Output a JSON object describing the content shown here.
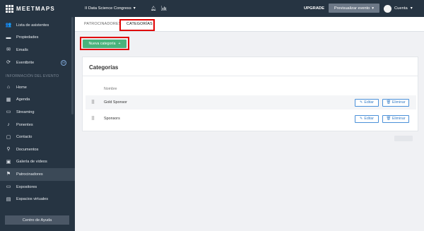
{
  "brand": {
    "name": "MEETMAPS"
  },
  "sidebar": {
    "top_items": [
      {
        "label": "Lista de asistentes",
        "icon": "users-icon",
        "glyph": "👥"
      },
      {
        "label": "Propiedades",
        "icon": "folder-icon",
        "glyph": "▬"
      },
      {
        "label": "Emails",
        "icon": "mail-icon",
        "glyph": "✉"
      },
      {
        "label": "Eventbrite",
        "icon": "sync-icon",
        "glyph": "⟳",
        "badge": "M"
      }
    ],
    "section_label": "INFORMACIÓN DEL EVENTO",
    "event_items": [
      {
        "label": "Home",
        "icon": "home-icon",
        "glyph": "⌂"
      },
      {
        "label": "Agenda",
        "icon": "calendar-icon",
        "glyph": "▦"
      },
      {
        "label": "Streaming",
        "icon": "streaming-icon",
        "glyph": "▭"
      },
      {
        "label": "Ponentes",
        "icon": "microphone-icon",
        "glyph": "♪"
      },
      {
        "label": "Contacto",
        "icon": "chat-icon",
        "glyph": "▢"
      },
      {
        "label": "Documentos",
        "icon": "paperclip-icon",
        "glyph": "⚲"
      },
      {
        "label": "Galería de videos",
        "icon": "video-icon",
        "glyph": "▣"
      },
      {
        "label": "Patrocinadores",
        "icon": "flag-icon",
        "glyph": "⚑",
        "active": true
      },
      {
        "label": "Expositores",
        "icon": "monitor-icon",
        "glyph": "▭"
      },
      {
        "label": "Espacios virtuales",
        "icon": "map-icon",
        "glyph": "▤"
      }
    ],
    "help_label": "Centro de Ayuda"
  },
  "topbar": {
    "event_name": "II Data Science Congress",
    "upgrade_label": "UPGRADE",
    "preview_label": "Previsualizar evento",
    "account_label": "Cuenta"
  },
  "tabs": [
    {
      "label": "PATROCINADORES",
      "active": false
    },
    {
      "label": "CATEGORÍAS",
      "active": true
    }
  ],
  "main": {
    "new_button_label": "Nueva categoría",
    "new_button_icon": "+",
    "card_title": "Categorías",
    "column_header": "Nombre",
    "rows": [
      {
        "name": "Gold Sponsor"
      },
      {
        "name": "Sponsors"
      }
    ],
    "edit_label": "Editar",
    "delete_label": "Eliminar"
  },
  "colors": {
    "sidebar_bg": "#263442",
    "accent_green": "#4ab37c",
    "highlight_red": "#e00000",
    "link_blue": "#3a80c9"
  }
}
